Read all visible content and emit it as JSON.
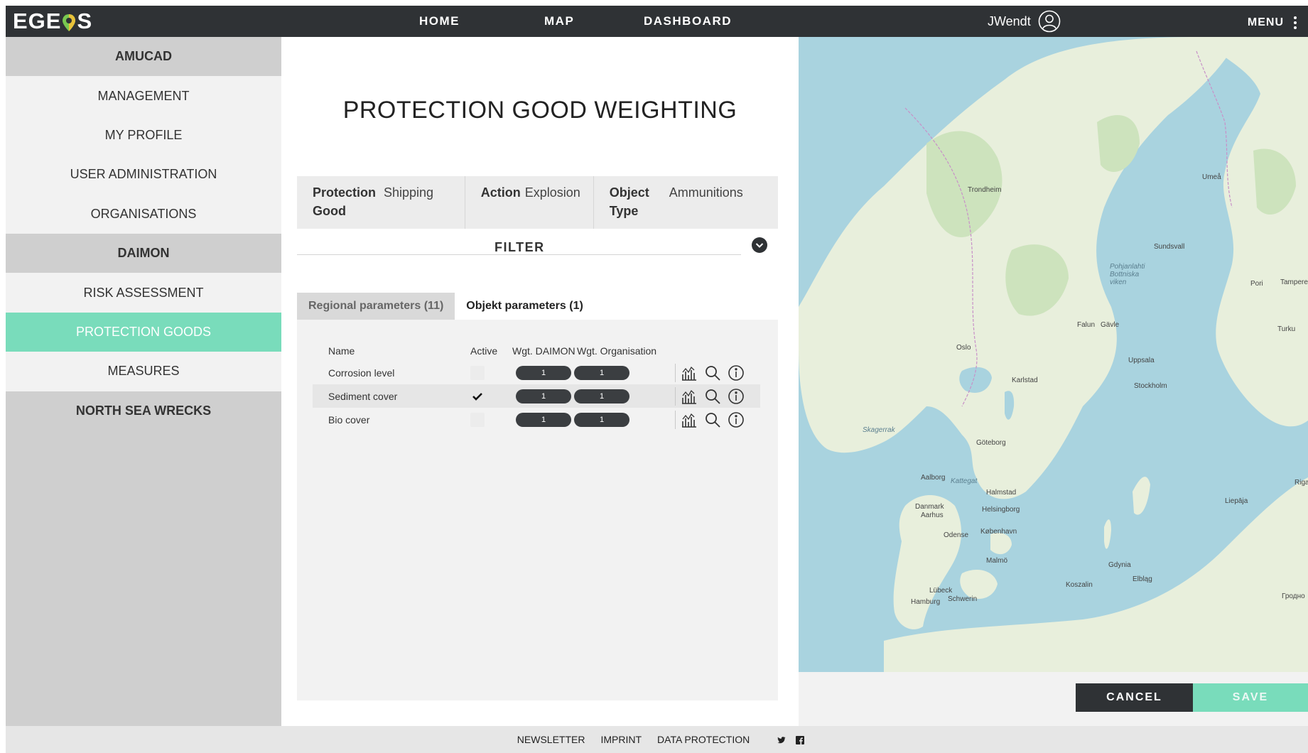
{
  "app": {
    "logo_left": "EGE",
    "logo_right": "S"
  },
  "nav": {
    "home": "HOME",
    "map": "MAP",
    "dashboard": "DASHBOARD"
  },
  "user": {
    "name": "JWendt"
  },
  "menu": {
    "label": "MENU"
  },
  "sidebar": {
    "items": [
      {
        "label": "AMUCAD",
        "kind": "section"
      },
      {
        "label": "MANAGEMENT",
        "kind": "item"
      },
      {
        "label": "MY PROFILE",
        "kind": "item"
      },
      {
        "label": "USER ADMINISTRATION",
        "kind": "item"
      },
      {
        "label": "ORGANISATIONS",
        "kind": "item"
      },
      {
        "label": "DAIMON",
        "kind": "section"
      },
      {
        "label": "RISK ASSESSMENT",
        "kind": "item"
      },
      {
        "label": "PROTECTION GOODS",
        "kind": "active"
      },
      {
        "label": "MEASURES",
        "kind": "item"
      },
      {
        "label": "NORTH SEA WRECKS",
        "kind": "section"
      }
    ]
  },
  "page": {
    "title": "PROTECTION GOOD WEIGHTING"
  },
  "summary": {
    "protection_good_key": "Protection Good",
    "protection_good_value": "Shipping",
    "action_key": "Action",
    "action_value": "Explosion",
    "object_type_key": "Object Type",
    "object_type_value": "Ammunitions"
  },
  "filter": {
    "label": "FILTER"
  },
  "tabs": {
    "regional": "Regional parameters (11)",
    "objekt": "Objekt parameters (1)"
  },
  "table": {
    "headers": {
      "name": "Name",
      "active": "Active",
      "wgt_daimon": "Wgt. DAIMON",
      "wgt_org": "Wgt. Organisation"
    },
    "rows": [
      {
        "name": "Corrosion level",
        "active": false,
        "wgt_daimon": "1",
        "wgt_org": "1"
      },
      {
        "name": "Sediment cover",
        "active": true,
        "wgt_daimon": "1",
        "wgt_org": "1"
      },
      {
        "name": "Bio cover",
        "active": false,
        "wgt_daimon": "1",
        "wgt_org": "1"
      }
    ]
  },
  "map_labels": {
    "trondheim": "Trondheim",
    "oslo": "Oslo",
    "stockholm": "Stockholm",
    "goteborg": "Göteborg",
    "umea": "Umeå",
    "uppsala": "Uppsala",
    "karlstad": "Karlstad",
    "falun": "Falun",
    "aalborg": "Aalborg",
    "danmark": "Danmark",
    "kobenhavn": "København",
    "malmo": "Malmö",
    "halmstad": "Halmstad",
    "helsingborg": "Helsingborg",
    "odense": "Odense",
    "aarhus": "Aarhus",
    "hamburg": "Hamburg",
    "schwerin": "Schwerin",
    "lubeck": "Lübeck",
    "gdynia": "Gdynia",
    "elblag": "Elbląg",
    "koszalin": "Koszalin",
    "riga": "Riga",
    "liepaja": "Liepāja",
    "tampere": "Tampere",
    "turku": "Turku",
    "pori": "Pori",
    "sundsvall": "Sundsvall",
    "gavle": "Gävle",
    "bothnia": "Pohjanlahti Bottniska viken",
    "grodno": "Гродно",
    "skagerrak": "Skagerrak",
    "kattegat": "Kattegat"
  },
  "actions": {
    "cancel": "CANCEL",
    "save": "SAVE"
  },
  "footer": {
    "newsletter": "NEWSLETTER",
    "imprint": "IMPRINT",
    "data_protection": "DATA PROTECTION"
  },
  "colors": {
    "accent": "#79dcbb",
    "dark": "#2f3235",
    "sea": "#a9d3df",
    "land": "#e8efdc"
  }
}
